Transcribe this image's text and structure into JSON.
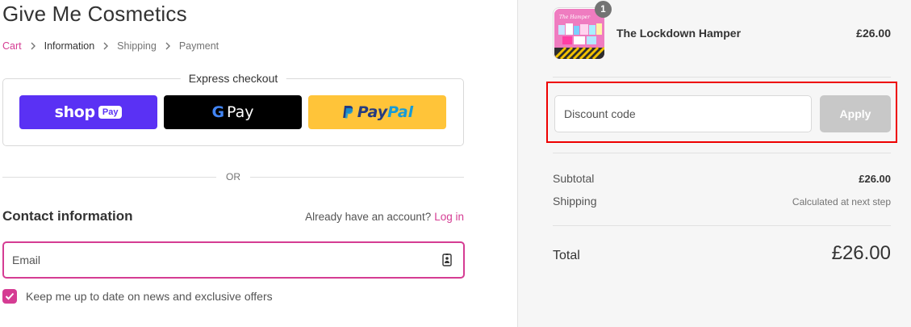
{
  "store": {
    "name": "Give Me Cosmetics"
  },
  "breadcrumb": [
    {
      "label": "Cart"
    },
    {
      "label": "Information"
    },
    {
      "label": "Shipping"
    },
    {
      "label": "Payment"
    }
  ],
  "express": {
    "title": "Express checkout",
    "shop_pay": {
      "word": "shop",
      "pill": "Pay",
      "icon": "shop-pay-logo"
    },
    "google_pay": {
      "g": "G",
      "pay": "Pay",
      "icon": "google-pay-logo"
    },
    "paypal": {
      "pay": "Pay",
      "pal": "Pal",
      "icon": "paypal-logo"
    }
  },
  "divider": {
    "label": "OR"
  },
  "contact": {
    "title": "Contact information",
    "account_prompt": "Already have an account?",
    "login_label": "Log in",
    "email_placeholder": "Email",
    "email_icon": "contact-card-icon",
    "newsletter_label": "Keep me up to date on news and exclusive offers",
    "newsletter_checked": true
  },
  "summary": {
    "product": {
      "name": "The Lockdown Hamper",
      "price": "£26.00",
      "quantity": "1",
      "thumbnail_text": "The Hamper"
    },
    "discount": {
      "placeholder": "Discount code",
      "apply_label": "Apply"
    },
    "subtotal": {
      "label": "Subtotal",
      "value": "£26.00"
    },
    "shipping": {
      "label": "Shipping",
      "value": "Calculated at next step"
    },
    "total": {
      "label": "Total",
      "value": "£26.00"
    }
  },
  "colors": {
    "accent": "#d53c93",
    "shop_pay": "#5a31f4",
    "paypal": "#ffc439",
    "highlight": "#ee0000",
    "apply_disabled": "#c8c8c8"
  }
}
